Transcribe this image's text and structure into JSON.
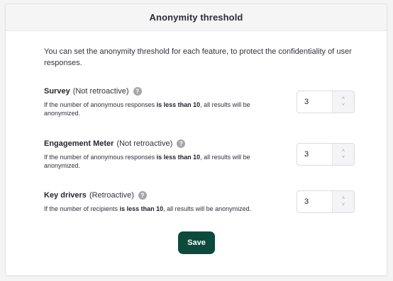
{
  "header": {
    "title": "Anonymity threshold"
  },
  "intro": "You can set the anonymity threshold for each feature, to protect the confidentiality of user responses.",
  "rows": [
    {
      "name": "Survey",
      "tag": "(Not retroactive)",
      "desc_before": "If the number of anonymous responses ",
      "desc_bold": "is less than 10",
      "desc_after": ", all results will be anonymized.",
      "value": "3"
    },
    {
      "name": "Engagement Meter",
      "tag": "(Not retroactive)",
      "desc_before": "If the number of anonymous responses ",
      "desc_bold": "is less than 10",
      "desc_after": ", all results will be anonymized.",
      "value": "3"
    },
    {
      "name": "Key drivers",
      "tag": "(Retroactive)",
      "desc_before": "If the number of recipients ",
      "desc_bold": "is less than 10",
      "desc_after": ", all results will be anonymized.",
      "value": "3"
    }
  ],
  "help_glyph": "?",
  "arrows": {
    "up": "˄",
    "down": "˅"
  },
  "save_label": "Save",
  "colors": {
    "save_button": "#0b4a3c",
    "help_icon": "#a4a6ab",
    "header_bg": "#f5f5f6"
  }
}
